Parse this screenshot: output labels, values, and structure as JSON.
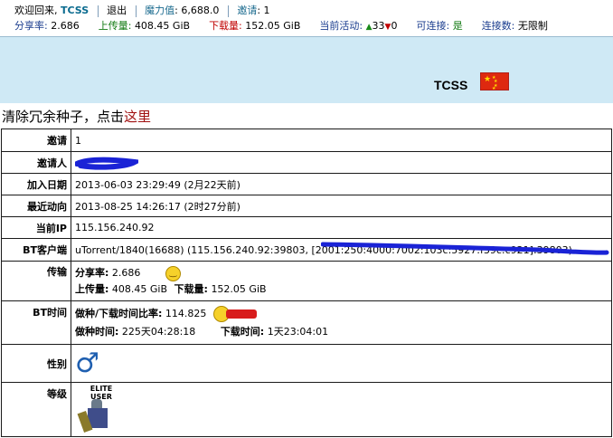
{
  "topbar": {
    "welcome": "欢迎回来,",
    "username": "TCSS",
    "logout": "退出",
    "magic_label": "魔力值",
    "magic_value": ": 6,688.0",
    "invite_label": "邀请",
    "invite_value": ": 1",
    "ratio_label": "分享率:",
    "ratio_value": "2.686",
    "upload_label": "上传量:",
    "upload_value": "408.45 GiB",
    "download_label": "下载量:",
    "download_value": "152.05 GiB",
    "activity_label": "当前活动:",
    "activity_seeding": "33",
    "activity_leeching": "0",
    "connectable_label": "可连接:",
    "connectable_value": "是",
    "connections_label": "连接数:",
    "connections_value": "无限制"
  },
  "header": {
    "username": "TCSS",
    "flag_icon": "china-flag-icon"
  },
  "clean_seeds": {
    "text": "清除冗余种子，点击",
    "link": "这里"
  },
  "rows": {
    "invite": {
      "label": "邀请",
      "value": "1"
    },
    "inviter": {
      "label": "邀请人"
    },
    "join_date": {
      "label": "加入日期",
      "value": "2013-06-03 23:29:49 (2月22天前)"
    },
    "last_action": {
      "label": "最近动向",
      "value": "2013-08-25 14:26:17 (2时27分前)"
    },
    "current_ip": {
      "label": "当前IP",
      "value": "115.156.240.92"
    },
    "bt_client": {
      "label": "BT客户端",
      "value": "uTorrent/1840(16688) (115.156.240.92:39803, [2001:250:4000:7002:103c:5927:f39c:c921]:39803)"
    },
    "transfer": {
      "label": "传输",
      "ratio_label": "分享率:",
      "ratio_value": "2.686",
      "upload_label": "上传量:",
      "upload_value": "408.45 GiB",
      "download_label": "下载量:",
      "download_value": "152.05 GiB"
    },
    "bt_time": {
      "label": "BT时间",
      "ratio_label": "做种/下载时间比率:",
      "ratio_value": "114.825",
      "seed_label": "做种时间:",
      "seed_value": "225天04:28:18",
      "dl_label": "下载时间:",
      "dl_value": "1天23:04:01"
    },
    "gender": {
      "label": "性别",
      "icon": "male-icon"
    },
    "class": {
      "label": "等级",
      "badge_text": "ELITE USER"
    }
  }
}
